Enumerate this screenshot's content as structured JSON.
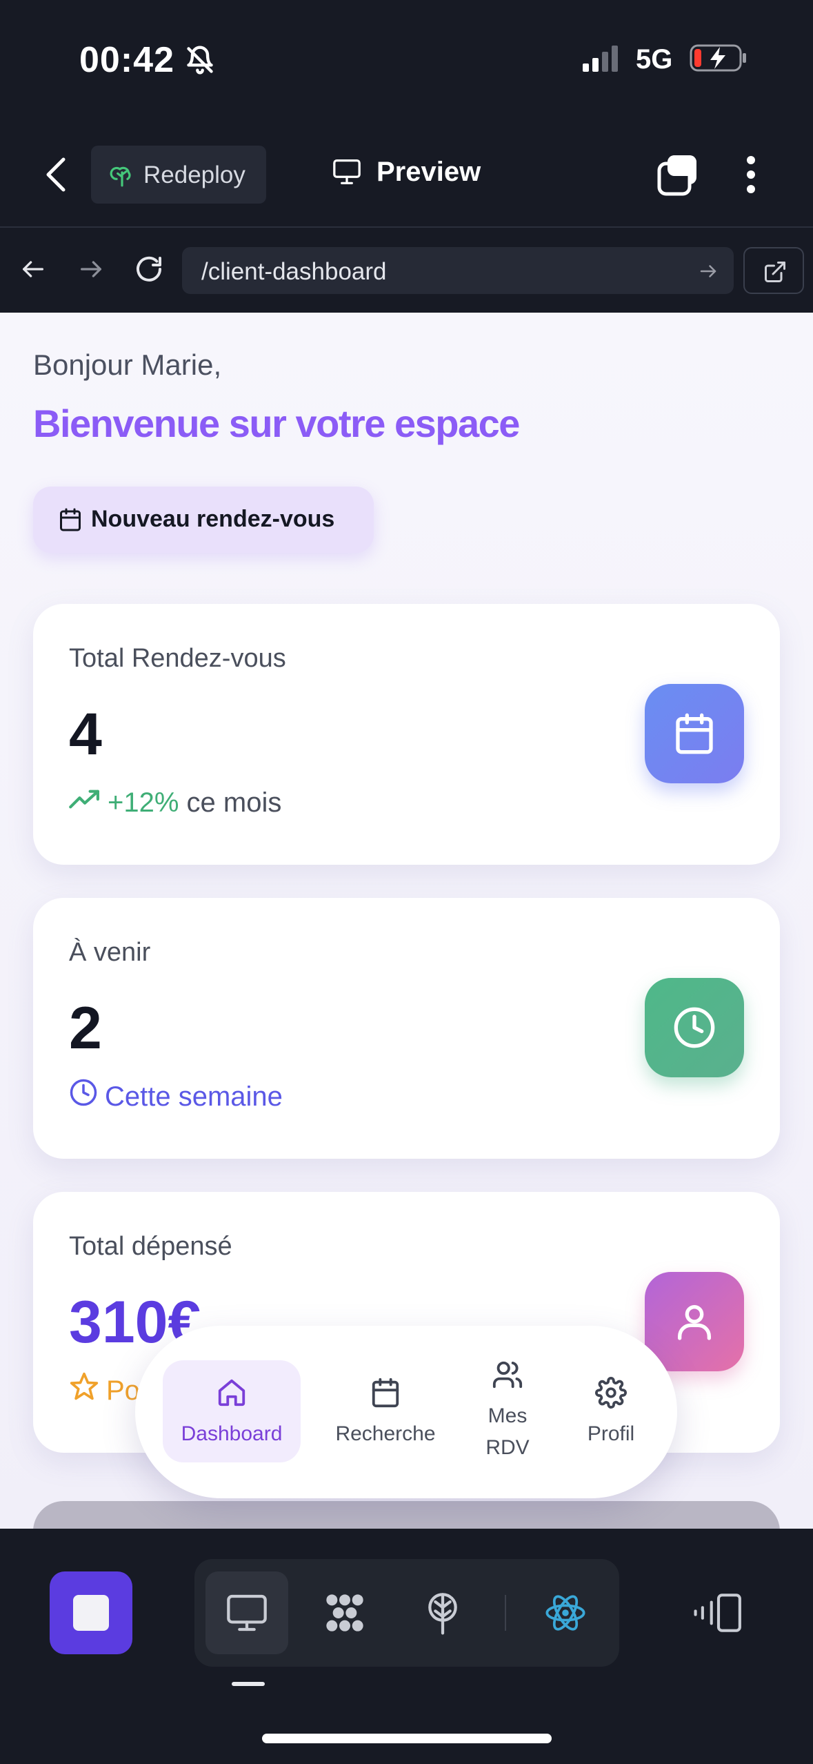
{
  "status_bar": {
    "time": "00:42",
    "network": "5G"
  },
  "app_header": {
    "chip_label": "Redeploy",
    "preview_label": "Preview"
  },
  "browser": {
    "url": "/client-dashboard"
  },
  "page": {
    "greeting": "Bonjour Marie,",
    "welcome": "Bienvenue sur votre espace",
    "new_appointment_label": "Nouveau rendez-vous",
    "cards": [
      {
        "title": "Total Rendez-vous",
        "value": "4",
        "note_highlight": "+12%",
        "note_rest": " ce mois",
        "icon": "calendar-icon"
      },
      {
        "title": "À venir",
        "value": "2",
        "note": "Cette semaine",
        "icon": "clock-icon"
      },
      {
        "title": "Total dépensé",
        "value": "310€",
        "note": "Po",
        "icon": "user-icon"
      }
    ]
  },
  "bottom_nav": {
    "items": [
      {
        "label": "Dashboard",
        "icon": "home-icon",
        "active": true
      },
      {
        "label": "Recherche",
        "icon": "calendar-icon"
      },
      {
        "label_line1": "Mes",
        "label_line2": "RDV",
        "icon": "users-icon"
      },
      {
        "label": "Profil",
        "icon": "gear-icon"
      }
    ]
  },
  "colors": {
    "accent_purple": "#8b5cf6",
    "positive_green": "#3fae76",
    "link_blue": "#5a58e6",
    "star_orange": "#f0a12a",
    "stop_button": "#5b3ce0"
  }
}
